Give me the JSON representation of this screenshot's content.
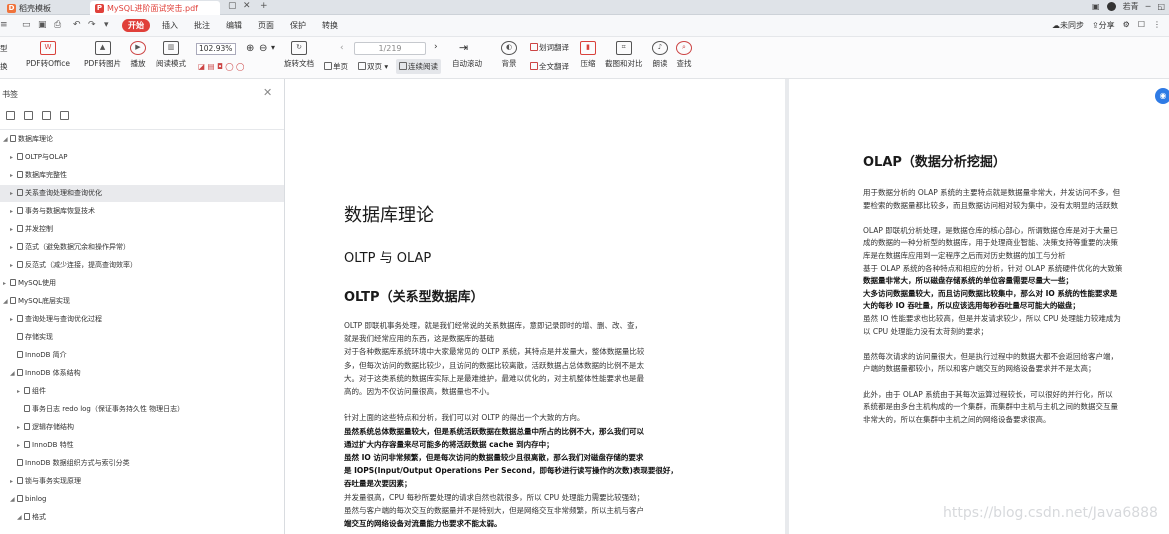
{
  "tabs": [
    {
      "label": "稻壳模板",
      "icon": "docer-icon",
      "color": "#f0733b",
      "active": false
    },
    {
      "label": "MySQL进阶面试突击.pdf",
      "icon": "pdf-icon",
      "color": "#e0403a",
      "active": true
    }
  ],
  "window": {
    "sync": "未同步",
    "share": "分享",
    "user": "若青"
  },
  "menu": {
    "items": [
      "开始",
      "插入",
      "批注",
      "编辑",
      "页面",
      "保护",
      "转换"
    ],
    "right": [
      "未同步",
      "分享"
    ]
  },
  "toolbar": {
    "left_partial": [
      "型",
      "换"
    ],
    "big": [
      "PDF转Office",
      "PDF转图片",
      "播放",
      "阅读模式",
      "旋转文档",
      "自动滚动",
      "背景",
      "压缩",
      "截图和对比",
      "朗读",
      "查找"
    ],
    "zoom": "102.93%",
    "page_value": "1/219",
    "single": "单页",
    "double": "双页",
    "continuous": "连续阅读",
    "translate": "划词翻译",
    "full_translate": "全文翻译"
  },
  "sidebar": {
    "title": "书签",
    "items": [
      {
        "label": "数据库理论",
        "level": 0,
        "expanded": true
      },
      {
        "label": "OLTP与OLAP",
        "level": 1
      },
      {
        "label": "数据库完整性",
        "level": 1
      },
      {
        "label": "关系查询处理和查询优化",
        "level": 1,
        "selected": true
      },
      {
        "label": "事务与数据库恢复技术",
        "level": 1
      },
      {
        "label": "并发控制",
        "level": 1
      },
      {
        "label": "范式（避免数据冗余和操作异常）",
        "level": 1
      },
      {
        "label": "反范式（减少连接，提高查询效率）",
        "level": 1
      },
      {
        "label": "MySQL使用",
        "level": 0
      },
      {
        "label": "MySQL底层实现",
        "level": 0,
        "expanded": true
      },
      {
        "label": "查询处理与查询优化过程",
        "level": 1
      },
      {
        "label": "存储实现",
        "level": 1,
        "leaf": true
      },
      {
        "label": "InnoDB 简介",
        "level": 1,
        "leaf": true
      },
      {
        "label": "InnoDB 体系结构",
        "level": 1,
        "expanded": true
      },
      {
        "label": "组件",
        "level": 2
      },
      {
        "label": "事务日志 redo log（保证事务持久性 物理日志）",
        "level": 2,
        "leaf": true
      },
      {
        "label": "逻辑存储结构",
        "level": 2
      },
      {
        "label": "InnoDB 特性",
        "level": 2
      },
      {
        "label": "InnoDB 数据组织方式与索引分类",
        "level": 1,
        "leaf": true
      },
      {
        "label": "锁与事务实现原理",
        "level": 1
      },
      {
        "label": "binlog",
        "level": 1,
        "expanded": true
      },
      {
        "label": "格式",
        "level": 2,
        "expanded": true
      }
    ]
  },
  "page1": {
    "h1": "数据库理论",
    "h2": "OLTP 与 OLAP",
    "h3": "OLTP（关系型数据库）",
    "lines": [
      {
        "t": "OLTP 即联机事务处理，就是我们经常说的关系数据库，意即记录即时的增、删、改、查，",
        "b": false
      },
      {
        "t": "就是我们经常应用的东西，这是数据库的基础",
        "b": false
      },
      {
        "t": "对于各种数据库系统环境中大家最常见的 OLTP 系统，其特点是并发量大，整体数据量比较",
        "b": false
      },
      {
        "t": "多，但每次访问的数据比较少，且访问的数据比较离散，活跃数据占总体数据的比例不是太",
        "b": false
      },
      {
        "t": "大。对于这类系统的数据库实际上是最难维护，最难以优化的，对主机整体性能要求也是最",
        "b": false
      },
      {
        "t": "高的。因为不仅访问量很高，数据量也不小。",
        "b": false
      },
      {
        "t": "",
        "b": false
      },
      {
        "t": "针对上面的这些特点和分析，我们可以对 OLTP 的得出一个大致的方向。",
        "b": false
      },
      {
        "t": "虽然系统总体数据量较大，但是系统活跃数据在数据总量中所占的比例不大，那么我们可以",
        "b": true
      },
      {
        "t": "通过扩大内存容量来尽可能多的将活跃数据 cache 到内存中；",
        "b": true
      },
      {
        "t": "虽然 IO 访问非常频繁，但是每次访问的数据量较少且很离散，那么我们对磁盘存储的要求",
        "b": true
      },
      {
        "t": "是 IOPS(Input/Output Operations Per Second，即每秒进行读写操作的次数)表现要很好，",
        "b": true
      },
      {
        "t": "吞吐量是次要因素；",
        "b": true
      },
      {
        "t": "并发量很高，CPU 每秒所要处理的请求自然也就很多，所以 CPU 处理能力需要比较强劲；",
        "b": false
      },
      {
        "t": "虽然与客户端的每次交互的数据量并不是特别大，但是网络交互非常频繁，所以主机与客户",
        "b": false
      },
      {
        "t": "端交互的网络设备对流量能力也要求不能太弱。",
        "b": true
      }
    ]
  },
  "page2": {
    "h2": "OLAP（数据分析挖掘）",
    "lines": [
      {
        "t": "用于数据分析的 OLAP 系统的主要特点就是数据量非常大，并发访问不多，但",
        "b": false
      },
      {
        "t": "要检索的数据量都比较多，而且数据访问相对较为集中，没有太明显的活跃数",
        "b": false
      },
      {
        "t": "",
        "b": false
      },
      {
        "t": "OLAP 即联机分析处理，是数据仓库的核心部心，所谓数据仓库是对于大量已",
        "b": false
      },
      {
        "t": "成的数据的一种分析型的数据库，用于处理商业智能、决策支持等重要的决策",
        "b": false
      },
      {
        "t": "库是在数据库应用到一定程序之后而对历史数据的加工与分析",
        "b": false
      },
      {
        "t": "基于 OLAP 系统的各种特点和相应的分析，针对 OLAP 系统硬件优化的大致策",
        "b": false
      },
      {
        "t": "数据量非常大，所以磁盘存储系统的单位容量需要尽量大一些；",
        "b": true
      },
      {
        "t": "大多访问数据量较大，而且访问数据比较集中，那么对 IO 系统的性能要求是",
        "b": true
      },
      {
        "t": "大的每秒 IO 吞吐量，所以应该选用每秒吞吐量尽可能大的磁盘；",
        "b": true
      },
      {
        "t": "虽然 IO 性能要求也比较高，但是并发请求较少，所以 CPU 处理能力较难成为",
        "b": false
      },
      {
        "t": "以 CPU 处理能力没有太苛刻的要求；",
        "b": false
      },
      {
        "t": "",
        "b": false
      },
      {
        "t": "虽然每次请求的访问量很大，但是执行过程中的数据大都不会返回给客户端，",
        "b": false
      },
      {
        "t": "户端的数据量都较小，所以和客户端交互的网络设备要求并不是太高；",
        "b": false
      },
      {
        "t": "",
        "b": false
      },
      {
        "t": " 此外，由于 OLAP 系统由于其每次运算过程较长，可以很好的并行化，所以",
        "b": false
      },
      {
        "t": "系统都是由多台主机构成的一个集群，而集群中主机与主机之间的数据交互量",
        "b": false
      },
      {
        "t": "非常大的，所以在集群中主机之间的网络设备要求很高。",
        "b": false
      }
    ]
  },
  "watermark": "https://blog.csdn.net/Java6888"
}
